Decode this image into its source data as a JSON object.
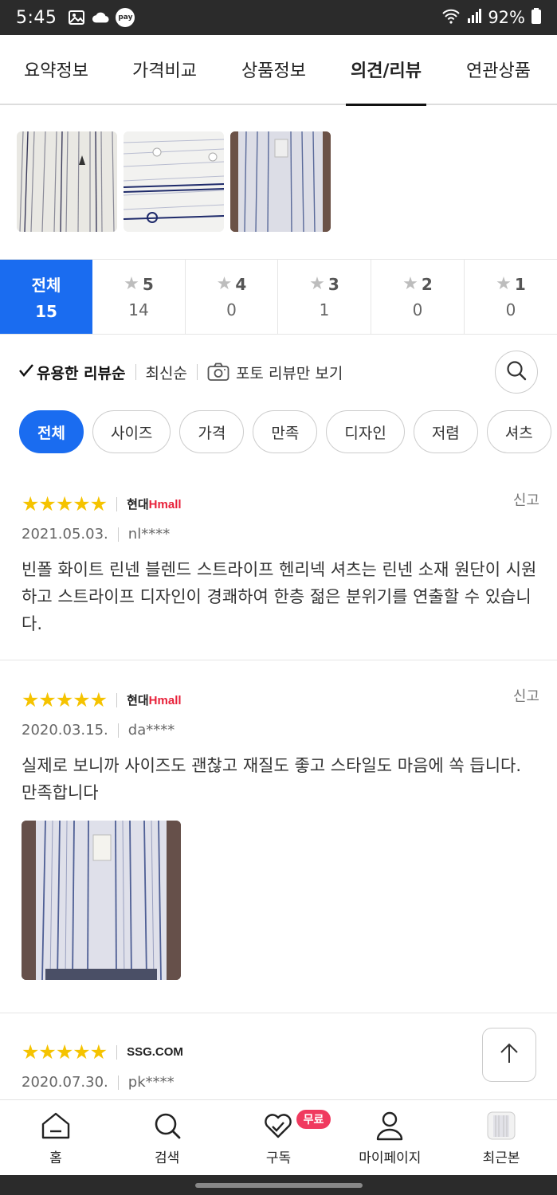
{
  "status_bar": {
    "time": "5:45",
    "battery": "92%",
    "left_icons": [
      "gallery-icon",
      "cloud-icon",
      "pay-icon"
    ],
    "pay_label": "pay"
  },
  "tabs": [
    {
      "label": "요약정보",
      "active": false
    },
    {
      "label": "가격비교",
      "active": false
    },
    {
      "label": "상품정보",
      "active": false
    },
    {
      "label": "의견/리뷰",
      "active": true
    },
    {
      "label": "연관상품",
      "active": false
    }
  ],
  "photo_thumbs": [
    "shirt-closeup-1",
    "shirt-closeup-2",
    "shirt-worn"
  ],
  "rating_filter": [
    {
      "label": "전체",
      "count": "15",
      "active": true,
      "has_star": false
    },
    {
      "label": "5",
      "count": "14",
      "active": false,
      "has_star": true
    },
    {
      "label": "4",
      "count": "0",
      "active": false,
      "has_star": true
    },
    {
      "label": "3",
      "count": "1",
      "active": false,
      "has_star": true
    },
    {
      "label": "2",
      "count": "0",
      "active": false,
      "has_star": true
    },
    {
      "label": "1",
      "count": "0",
      "active": false,
      "has_star": true
    }
  ],
  "sort": {
    "helpful": "유용한 리뷰순",
    "latest": "최신순",
    "photo_only": "포토 리뷰만 보기"
  },
  "chips": [
    "전체",
    "사이즈",
    "가격",
    "만족",
    "디자인",
    "저렴",
    "셔츠"
  ],
  "reviews": [
    {
      "rating": 5,
      "mall": "현대Hmall",
      "mall_prefix": "현대",
      "mall_h": "H",
      "mall_rest": "mall",
      "report": "신고",
      "date": "2021.05.03.",
      "user": "nl****",
      "text": "빈폴 화이트 린넨 블렌드 스트라이프 헨리넥 셔츠는 린넨 소재 원단이 시원하고 스트라이프 디자인이 경쾌하여 한층 젊은 분위기를 연출할 수 있습니다.",
      "has_photo": false
    },
    {
      "rating": 5,
      "mall": "현대Hmall",
      "mall_prefix": "현대",
      "mall_h": "H",
      "mall_rest": "mall",
      "report": "신고",
      "date": "2020.03.15.",
      "user": "da****",
      "text": "실제로 보니까 사이즈도 괜찮고 재질도 좋고 스타일도 마음에 쏙 듭니다. 만족합니다",
      "has_photo": true
    },
    {
      "rating": 5,
      "mall": "SSG.COM",
      "report": "",
      "date": "2020.07.30.",
      "user": "pk****",
      "text": "",
      "has_photo": false
    }
  ],
  "bottom_nav": [
    {
      "label": "홈",
      "icon": "home-icon"
    },
    {
      "label": "검색",
      "icon": "search-icon"
    },
    {
      "label": "구독",
      "icon": "subscribe-heart-icon",
      "badge": "무료"
    },
    {
      "label": "마이페이지",
      "icon": "person-icon"
    },
    {
      "label": "최근본",
      "icon": "recent-thumb-icon"
    }
  ],
  "colors": {
    "accent": "#1a6cf0",
    "star": "#f5c300",
    "badge": "#f03a5f",
    "hmall_red": "#e8213a"
  }
}
